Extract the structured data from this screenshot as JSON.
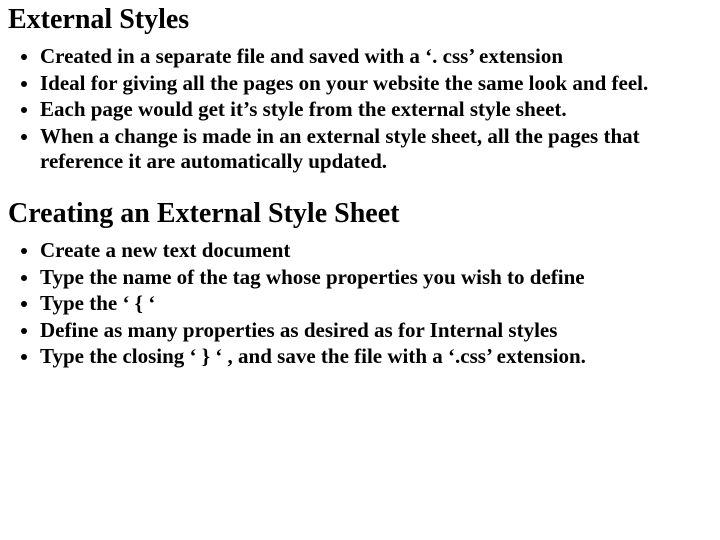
{
  "sections": [
    {
      "heading": "External Styles",
      "bullets": [
        "Created in a separate file and saved with a ‘. css’ extension",
        "Ideal for giving all the pages on your website the same look and feel.",
        "Each page would get it’s style from the external style sheet.",
        "When a change is made in an external style sheet, all the pages that reference it are automatically updated."
      ]
    },
    {
      "heading": "Creating an External Style Sheet",
      "bullets": [
        "Create a new text document",
        "Type the name of the tag whose properties you wish to define",
        "Type the ‘ { ‘",
        "Define as many properties as desired as for Internal styles",
        "Type the closing ‘ } ‘ , and save the file with a ‘.css’ extension."
      ]
    }
  ]
}
